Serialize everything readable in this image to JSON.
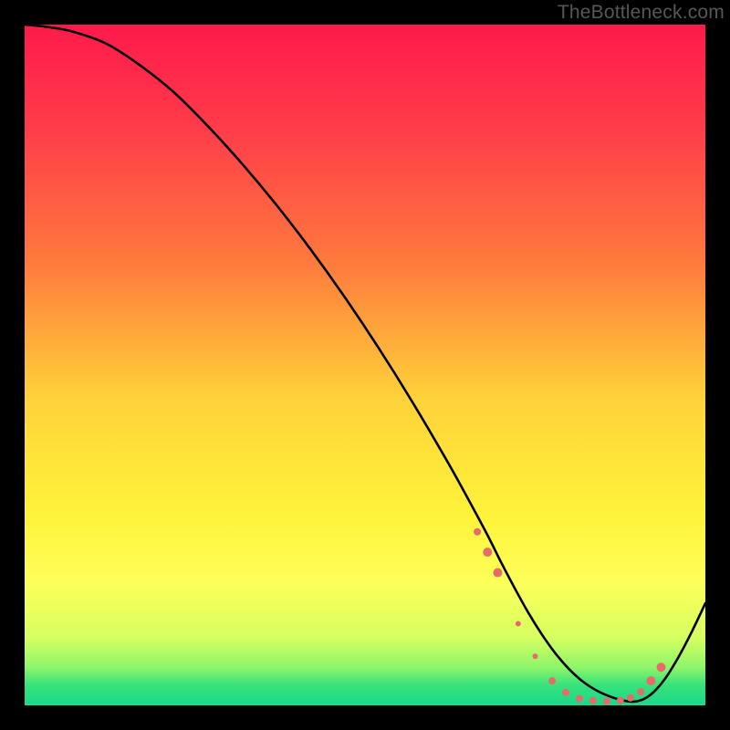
{
  "watermark": "TheBottleneck.com",
  "chart_data": {
    "type": "line",
    "title": "",
    "xlabel": "",
    "ylabel": "",
    "xlim": [
      0,
      100
    ],
    "ylim": [
      0,
      100
    ],
    "gradient_stops": [
      {
        "offset": 0,
        "color": "#ff1a4b"
      },
      {
        "offset": 0.15,
        "color": "#ff3b4a"
      },
      {
        "offset": 0.35,
        "color": "#ff7a3c"
      },
      {
        "offset": 0.55,
        "color": "#ffd23a"
      },
      {
        "offset": 0.72,
        "color": "#fff339"
      },
      {
        "offset": 0.82,
        "color": "#fdff5a"
      },
      {
        "offset": 0.9,
        "color": "#d7ff60"
      },
      {
        "offset": 0.945,
        "color": "#8cf56a"
      },
      {
        "offset": 0.97,
        "color": "#38e27a"
      },
      {
        "offset": 1.0,
        "color": "#19d98a"
      }
    ],
    "series": [
      {
        "name": "bottleneck-curve",
        "x": [
          0,
          3,
          7,
          12,
          17,
          22,
          27,
          32,
          37,
          42,
          47,
          52,
          57,
          62,
          65,
          68,
          70,
          72,
          74,
          76,
          78,
          80,
          82,
          84,
          86,
          88,
          90,
          92,
          94,
          96,
          98,
          100
        ],
        "y": [
          100,
          99.7,
          99,
          97.2,
          94,
          90,
          85,
          79.5,
          73.5,
          67,
          60,
          52.5,
          44.5,
          36,
          30.6,
          25,
          21,
          17.2,
          13.6,
          10.4,
          7.6,
          5.3,
          3.5,
          2.2,
          1.3,
          0.7,
          0.6,
          1.6,
          3.8,
          7.0,
          10.8,
          15
        ]
      }
    ],
    "marker_cluster": {
      "color": "#e86b6b",
      "points": [
        {
          "x": 66.5,
          "y": 25.5,
          "r": 4
        },
        {
          "x": 68.0,
          "y": 22.5,
          "r": 5
        },
        {
          "x": 69.5,
          "y": 19.5,
          "r": 5
        },
        {
          "x": 72.5,
          "y": 12.0,
          "r": 3
        },
        {
          "x": 75.0,
          "y": 7.2,
          "r": 3
        },
        {
          "x": 77.5,
          "y": 3.6,
          "r": 4
        },
        {
          "x": 79.5,
          "y": 1.9,
          "r": 4
        },
        {
          "x": 81.5,
          "y": 1.0,
          "r": 4
        },
        {
          "x": 83.5,
          "y": 0.7,
          "r": 4
        },
        {
          "x": 85.5,
          "y": 0.6,
          "r": 4
        },
        {
          "x": 87.5,
          "y": 0.7,
          "r": 4
        },
        {
          "x": 89.0,
          "y": 1.1,
          "r": 4
        },
        {
          "x": 90.5,
          "y": 2.0,
          "r": 4
        },
        {
          "x": 92.0,
          "y": 3.6,
          "r": 5
        },
        {
          "x": 93.5,
          "y": 5.6,
          "r": 5
        }
      ]
    }
  }
}
